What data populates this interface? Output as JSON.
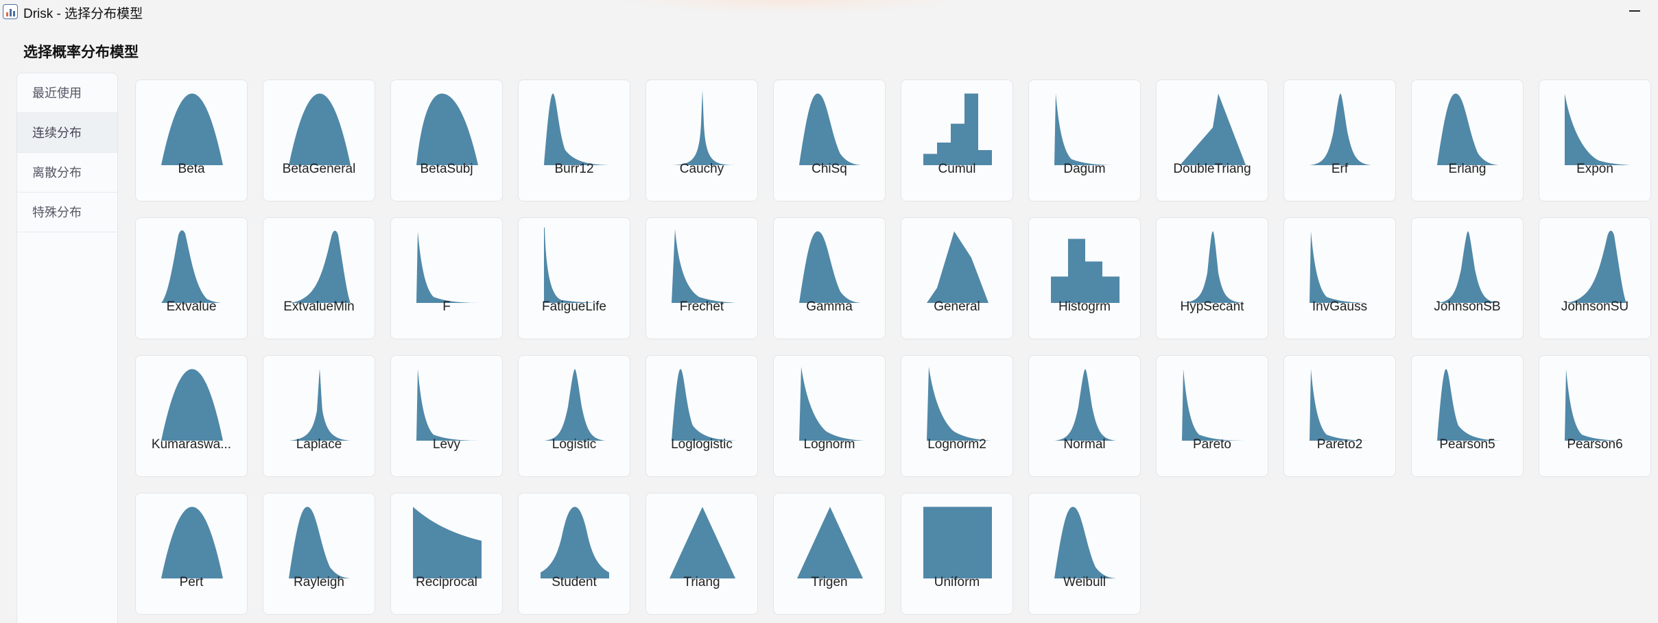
{
  "window": {
    "title": "Drisk - 选择分布模型"
  },
  "page": {
    "title": "选择概率分布模型"
  },
  "colors": {
    "shape_fill": "#5088a8",
    "background": "#f3f3f3",
    "card": "#fbfcfd"
  },
  "sidebar": {
    "items": [
      {
        "label": "最近使用",
        "active": false
      },
      {
        "label": "连续分布",
        "active": true
      },
      {
        "label": "离散分布",
        "active": false
      },
      {
        "label": "特殊分布",
        "active": false
      }
    ]
  },
  "distributions": [
    {
      "label": "Beta",
      "shape": "bell-wide"
    },
    {
      "label": "BetaGeneral",
      "shape": "bell-wide"
    },
    {
      "label": "BetaSubj",
      "shape": "beta-skew"
    },
    {
      "label": "Burr12",
      "shape": "spike-right"
    },
    {
      "label": "Cauchy",
      "shape": "needle"
    },
    {
      "label": "ChiSq",
      "shape": "skew-right"
    },
    {
      "label": "Cumul",
      "shape": "stairs"
    },
    {
      "label": "Dagum",
      "shape": "spike-decay"
    },
    {
      "label": "DoubleTriang",
      "shape": "double-triang"
    },
    {
      "label": "Erf",
      "shape": "bell"
    },
    {
      "label": "Erlang",
      "shape": "skew-right"
    },
    {
      "label": "Expon",
      "shape": "expon"
    },
    {
      "label": "Extvalue",
      "shape": "extvalue"
    },
    {
      "label": "ExtvalueMin",
      "shape": "extvalue-min"
    },
    {
      "label": "F",
      "shape": "spike-decay"
    },
    {
      "label": "FatigueLife",
      "shape": "l-shape"
    },
    {
      "label": "Frechet",
      "shape": "frechet"
    },
    {
      "label": "Gamma",
      "shape": "skew-right"
    },
    {
      "label": "General",
      "shape": "general"
    },
    {
      "label": "Histogrm",
      "shape": "histogram"
    },
    {
      "label": "HypSecant",
      "shape": "bell-sharp"
    },
    {
      "label": "InvGauss",
      "shape": "spike-decay"
    },
    {
      "label": "JohnsonSB",
      "shape": "bell"
    },
    {
      "label": "JohnsonSU",
      "shape": "extvalue-min"
    },
    {
      "label": "Kumaraswa...",
      "shape": "bell-wide"
    },
    {
      "label": "Laplace",
      "shape": "laplace-like"
    },
    {
      "label": "Levy",
      "shape": "spike-decay"
    },
    {
      "label": "Logistic",
      "shape": "bell"
    },
    {
      "label": "Loglogistic",
      "shape": "spike-right"
    },
    {
      "label": "Lognorm",
      "shape": "lognorm"
    },
    {
      "label": "Lognorm2",
      "shape": "lognorm"
    },
    {
      "label": "Normal",
      "shape": "bell"
    },
    {
      "label": "Pareto",
      "shape": "spike-decay"
    },
    {
      "label": "Pareto2",
      "shape": "spike-decay"
    },
    {
      "label": "Pearson5",
      "shape": "spike-right"
    },
    {
      "label": "Pearson6",
      "shape": "spike-decay"
    },
    {
      "label": "Pert",
      "shape": "bell-wide"
    },
    {
      "label": "Rayleigh",
      "shape": "skew-right"
    },
    {
      "label": "Reciprocal",
      "shape": "reciprocal"
    },
    {
      "label": "Student",
      "shape": "student"
    },
    {
      "label": "Triang",
      "shape": "triangle"
    },
    {
      "label": "Trigen",
      "shape": "triangle"
    },
    {
      "label": "Uniform",
      "shape": "uniform"
    },
    {
      "label": "Weibull",
      "shape": "skew-right"
    }
  ]
}
